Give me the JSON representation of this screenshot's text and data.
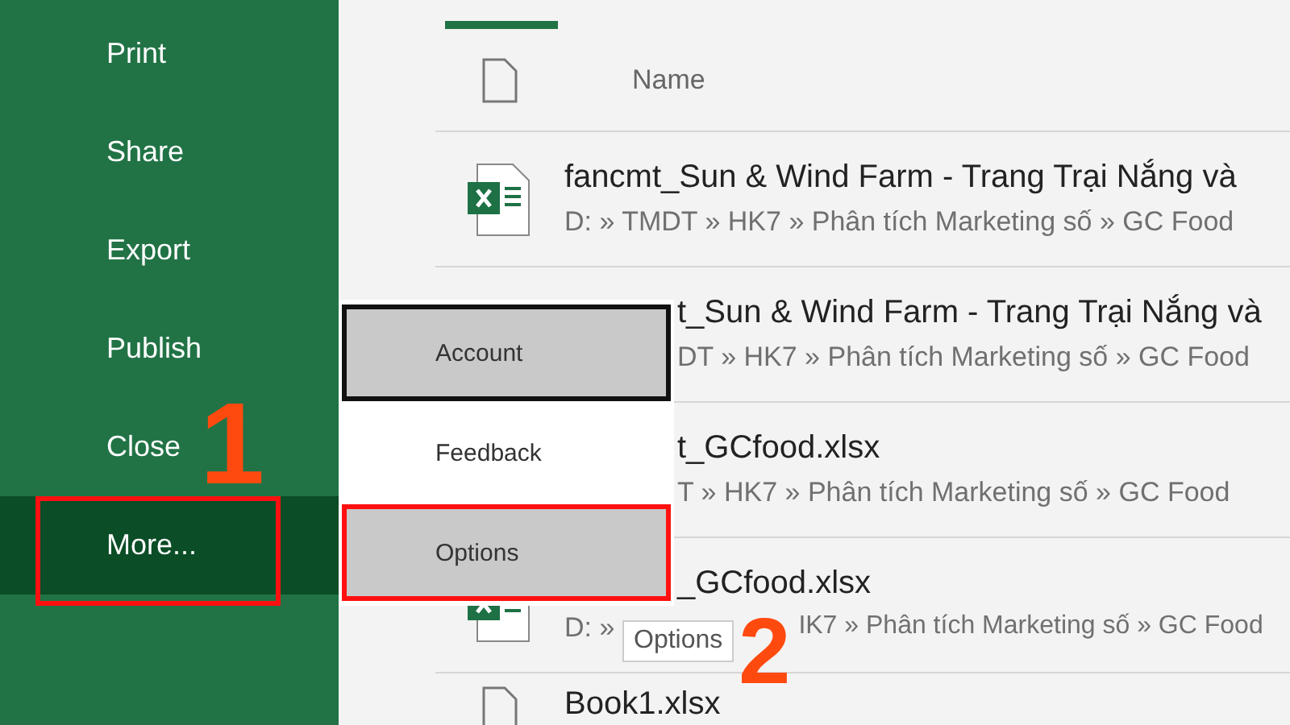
{
  "sidebar": {
    "items": [
      {
        "label": "Print",
        "selected": false
      },
      {
        "label": "Share",
        "selected": false
      },
      {
        "label": "Export",
        "selected": false
      },
      {
        "label": "Publish",
        "selected": false
      },
      {
        "label": "Close",
        "selected": false
      },
      {
        "label": "More...",
        "selected": true
      }
    ]
  },
  "file_list": {
    "header": "Name",
    "rows": [
      {
        "kind": "full",
        "title": "fancmt_Sun & Wind Farm - Trang Trại Nắng và",
        "path": "D: » TMDT » HK7 » Phân tích Marketing số » GC Food"
      },
      {
        "kind": "covered",
        "title": "t_Sun & Wind Farm - Trang Trại Nắng và",
        "path": "DT » HK7 » Phân tích Marketing số » GC Food"
      },
      {
        "kind": "covered",
        "title": "t_GCfood.xlsx",
        "path": "T » HK7 » Phân tích Marketing số » GC Food"
      },
      {
        "kind": "partial",
        "title": "_GCfood.xlsx",
        "path": "D: »",
        "path_end": "IK7 » Phân tích Marketing số » GC Food",
        "tooltip": "Options"
      },
      {
        "kind": "blank",
        "title": "Book1.xlsx"
      }
    ]
  },
  "more_menu": {
    "items": [
      {
        "label": "Account",
        "selected": true
      },
      {
        "label": "Feedback",
        "selected": false
      },
      {
        "label": "Options",
        "selected": true
      }
    ]
  },
  "annotations": [
    "1",
    "2"
  ]
}
